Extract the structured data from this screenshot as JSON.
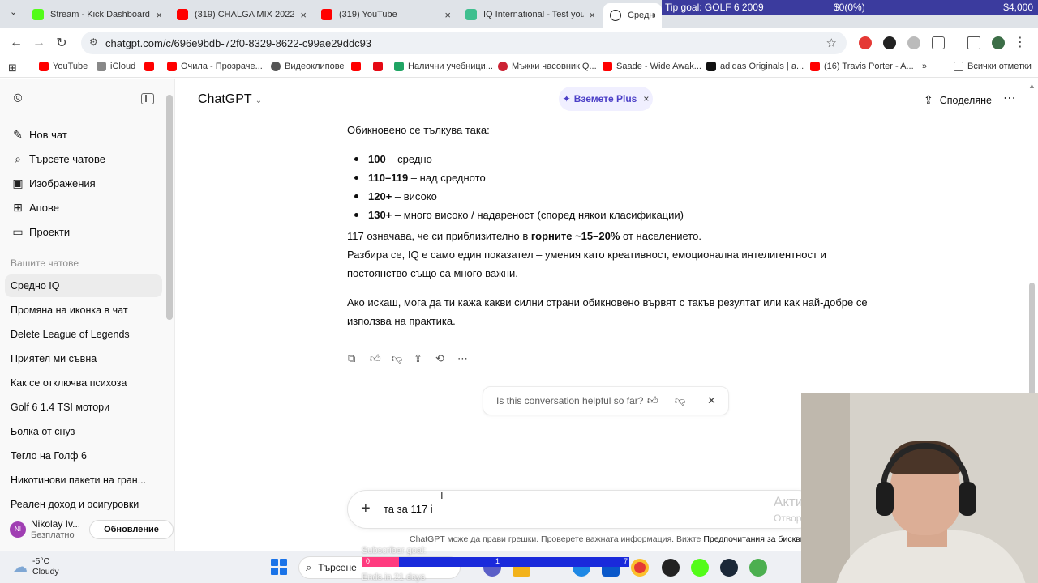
{
  "browser": {
    "tabs": [
      {
        "title": "Stream - Kick Dashboard",
        "favicon_color": "#53fc18"
      },
      {
        "title": "(319) CHALGA MIX 2022 H",
        "favicon_color": "#ff0000"
      },
      {
        "title": "(319) YouTube",
        "favicon_color": "#ff0000"
      },
      {
        "title": "IQ International - Test your",
        "favicon_color": "#3fbf8f"
      },
      {
        "title": "Средно IQ",
        "favicon_color": "#222222"
      }
    ],
    "url": "chatgpt.com/c/696e9bdb-72f0-8329-8622-c99ae29ddc93",
    "bookmarks": [
      {
        "label": "YouTube",
        "color": "#ff0000"
      },
      {
        "label": "iCloud",
        "color": "#888888"
      },
      {
        "label": "Очила - Прозрачe...",
        "color": "#ff0000"
      },
      {
        "label": "Видеоклипове",
        "color": "#555555"
      },
      {
        "label": "",
        "color": "#ff0000"
      },
      {
        "label": "",
        "color": "#e50914"
      },
      {
        "label": "Налични учебници...",
        "color": "#1fa463"
      },
      {
        "label": "Мъжки часовник Q...",
        "color": "#cc2233"
      },
      {
        "label": "Saade - Wide Awak...",
        "color": "#ff0000"
      },
      {
        "label": "adidas Originals | a...",
        "color": "#111111"
      },
      {
        "label": "(16) Travis Porter - A...",
        "color": "#ff0000"
      },
      {
        "label": "Всички отметки",
        "color": "#666666"
      }
    ]
  },
  "overlay": {
    "tip_goal": "Tip goal: GOLF 6 2009",
    "tip_progress": "$0(0%)",
    "tip_target": "$4,000",
    "sub_label": "Subscriber goal:",
    "sub_current": "0",
    "sub_mid": "1",
    "sub_target": "7",
    "sub_ends": "Ends in 21 days"
  },
  "sidebar": {
    "nav": [
      {
        "label": "Нов чат",
        "icon": "new-chat-icon",
        "glyph": "✎"
      },
      {
        "label": "Търсете чатове",
        "icon": "search-icon",
        "glyph": "⌕"
      },
      {
        "label": "Изображения",
        "icon": "images-icon",
        "glyph": "▣"
      },
      {
        "label": "Апове",
        "icon": "apps-icon",
        "glyph": "⊞"
      },
      {
        "label": "Проекти",
        "icon": "folder-icon",
        "glyph": "▭"
      }
    ],
    "section_label": "Вашите чатове",
    "chats": [
      "Средно IQ",
      "Промяна на иконка в чат",
      "Delete League of Legends",
      "Приятел ми съвна",
      "Как се отключва психоза",
      "Golf 6 1.4 TSI мотори",
      "Болка от снуз",
      "Тегло на Голф 6",
      "Никотинови пакети на гран...",
      "Реален доход и осигуровки"
    ],
    "user": {
      "initials": "NI",
      "name": "Nikolay Iv...",
      "plan": "Безплатно",
      "upgrade": "Обновление"
    }
  },
  "header": {
    "model": "ChatGPT",
    "plus_pill": "Вземете Plus",
    "share": "Споделяне"
  },
  "message": {
    "intro": "Обикновено се тълкува така:",
    "bullets": [
      {
        "bold": "100",
        "text": " – средно"
      },
      {
        "bold": "110–119",
        "text": " – над средното"
      },
      {
        "bold": "120+",
        "text": " – високо"
      },
      {
        "bold": "130+",
        "text": " – много високо / надареност (според някои класификации)"
      }
    ],
    "p1_pre": "117 означава, че си приблизително в ",
    "p1_bold": "горните ~15–20%",
    "p1_post": " от населението.",
    "p2": "Разбира се, IQ е само един показател – умения като креативност, емоционална интелигентност и постоянство също са много важни.",
    "p3": "Ако искаш, мога да ти кажа какви силни страни обикновено вървят с такъв резултат или как най-добре се използва на практика."
  },
  "feedback": {
    "question": "Is this conversation helpful so far?"
  },
  "composer": {
    "input_value": "та за 117 i",
    "win_activation": "Акти",
    "win_activation2": "Отвор"
  },
  "disclaimer": {
    "text": "ChatGPT може да прави грешки. Проверете важната информация. Вижте ",
    "link": "Предпочитания за бисквитите"
  },
  "taskbar": {
    "weather_temp": "-5°C",
    "weather_desc": "Cloudy",
    "search": "Търсене"
  }
}
